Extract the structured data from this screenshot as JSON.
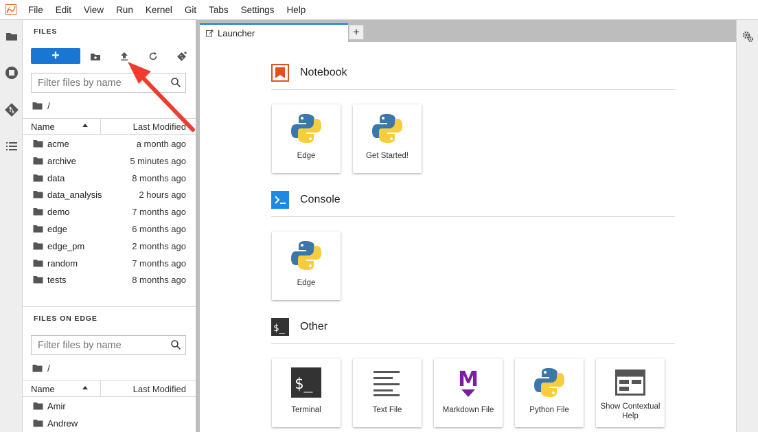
{
  "menubar": {
    "items": [
      "File",
      "Edit",
      "View",
      "Run",
      "Kernel",
      "Git",
      "Tabs",
      "Settings",
      "Help"
    ]
  },
  "activity_icons": [
    "folder-icon",
    "running-icon",
    "git-icon",
    "toc-icon"
  ],
  "file_browser": {
    "title": "FILES",
    "new_label": "+",
    "filter_placeholder": "Filter files by name",
    "path": "/",
    "col_name": "Name",
    "col_modified": "Last Modified",
    "items": [
      {
        "name": "acme",
        "modified": "a month ago"
      },
      {
        "name": "archive",
        "modified": "5 minutes ago"
      },
      {
        "name": "data",
        "modified": "8 months ago"
      },
      {
        "name": "data_analysis",
        "modified": "2 hours ago"
      },
      {
        "name": "demo",
        "modified": "7 months ago"
      },
      {
        "name": "edge",
        "modified": "6 months ago"
      },
      {
        "name": "edge_pm",
        "modified": "2 months ago"
      },
      {
        "name": "random",
        "modified": "7 months ago"
      },
      {
        "name": "tests",
        "modified": "8 months ago"
      }
    ]
  },
  "edge_browser": {
    "title": "FILES ON EDGE",
    "filter_placeholder": "Filter files by name",
    "path": "/",
    "col_name": "Name",
    "col_modified": "Last Modified",
    "items": [
      {
        "name": "Amir"
      },
      {
        "name": "Andrew"
      }
    ]
  },
  "tabs": {
    "active_label": "Launcher",
    "add_label": "+"
  },
  "launcher": {
    "notebook": {
      "label": "Notebook",
      "cards": [
        {
          "label": "Edge"
        },
        {
          "label": "Get Started!"
        }
      ]
    },
    "console": {
      "label": "Console",
      "cards": [
        {
          "label": "Edge"
        }
      ]
    },
    "other": {
      "label": "Other",
      "cards": [
        {
          "label": "Terminal",
          "glyph": "$_"
        },
        {
          "label": "Text File"
        },
        {
          "label": "Markdown File",
          "glyph": "M"
        },
        {
          "label": "Python File"
        },
        {
          "label": "Show Contextual Help"
        }
      ]
    }
  },
  "colors": {
    "accent": "#1976d2",
    "annotation_arrow": "#f03c2e",
    "notebook_icon": "#e0521f",
    "console_icon": "#1e88e5",
    "markdown": "#7b1fa2"
  }
}
